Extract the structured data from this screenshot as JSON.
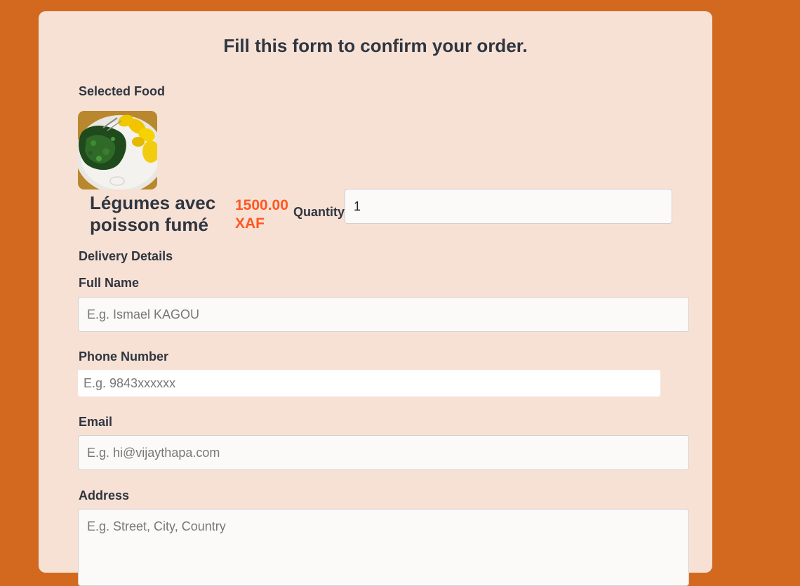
{
  "form": {
    "title": "Fill this form to confirm your order."
  },
  "selected_food": {
    "section_label": "Selected Food",
    "image": "food-image-greens-with-plantain",
    "name": "Légumes avec poisson fumé",
    "price": "1500.00 XAF",
    "quantity_label": "Quantity",
    "quantity_value": "1"
  },
  "delivery": {
    "section_label": "Delivery Details",
    "full_name_label": "Full Name",
    "full_name_placeholder": "E.g. Ismael KAGOU",
    "phone_label": "Phone Number",
    "phone_placeholder": "E.g. 9843xxxxxx",
    "email_label": "Email",
    "email_placeholder": "E.g. hi@vijaythapa.com",
    "address_label": "Address",
    "address_placeholder": "E.g. Street, City, Country"
  }
}
